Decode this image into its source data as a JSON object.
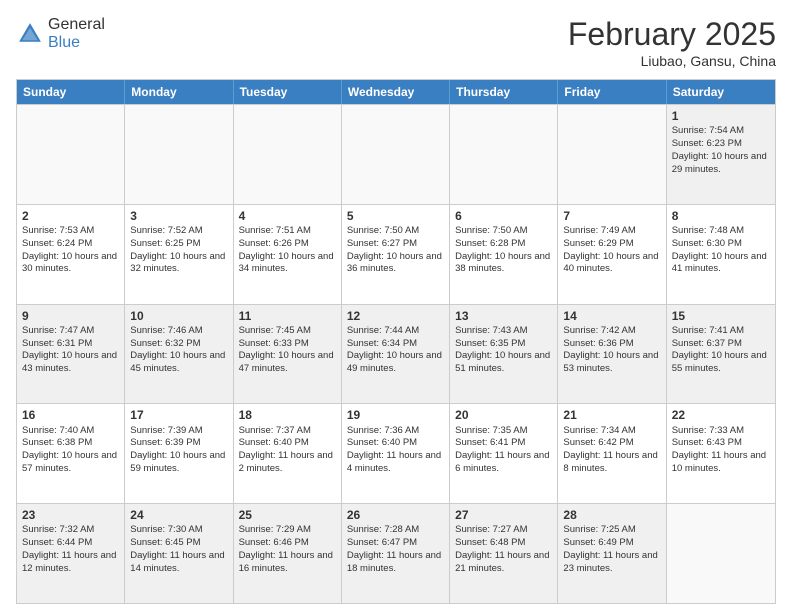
{
  "header": {
    "logo_general": "General",
    "logo_blue": "Blue",
    "month_title": "February 2025",
    "subtitle": "Liubao, Gansu, China"
  },
  "weekdays": [
    "Sunday",
    "Monday",
    "Tuesday",
    "Wednesday",
    "Thursday",
    "Friday",
    "Saturday"
  ],
  "rows": [
    [
      {
        "day": "",
        "info": ""
      },
      {
        "day": "",
        "info": ""
      },
      {
        "day": "",
        "info": ""
      },
      {
        "day": "",
        "info": ""
      },
      {
        "day": "",
        "info": ""
      },
      {
        "day": "",
        "info": ""
      },
      {
        "day": "1",
        "info": "Sunrise: 7:54 AM\nSunset: 6:23 PM\nDaylight: 10 hours and 29 minutes."
      }
    ],
    [
      {
        "day": "2",
        "info": "Sunrise: 7:53 AM\nSunset: 6:24 PM\nDaylight: 10 hours and 30 minutes."
      },
      {
        "day": "3",
        "info": "Sunrise: 7:52 AM\nSunset: 6:25 PM\nDaylight: 10 hours and 32 minutes."
      },
      {
        "day": "4",
        "info": "Sunrise: 7:51 AM\nSunset: 6:26 PM\nDaylight: 10 hours and 34 minutes."
      },
      {
        "day": "5",
        "info": "Sunrise: 7:50 AM\nSunset: 6:27 PM\nDaylight: 10 hours and 36 minutes."
      },
      {
        "day": "6",
        "info": "Sunrise: 7:50 AM\nSunset: 6:28 PM\nDaylight: 10 hours and 38 minutes."
      },
      {
        "day": "7",
        "info": "Sunrise: 7:49 AM\nSunset: 6:29 PM\nDaylight: 10 hours and 40 minutes."
      },
      {
        "day": "8",
        "info": "Sunrise: 7:48 AM\nSunset: 6:30 PM\nDaylight: 10 hours and 41 minutes."
      }
    ],
    [
      {
        "day": "9",
        "info": "Sunrise: 7:47 AM\nSunset: 6:31 PM\nDaylight: 10 hours and 43 minutes."
      },
      {
        "day": "10",
        "info": "Sunrise: 7:46 AM\nSunset: 6:32 PM\nDaylight: 10 hours and 45 minutes."
      },
      {
        "day": "11",
        "info": "Sunrise: 7:45 AM\nSunset: 6:33 PM\nDaylight: 10 hours and 47 minutes."
      },
      {
        "day": "12",
        "info": "Sunrise: 7:44 AM\nSunset: 6:34 PM\nDaylight: 10 hours and 49 minutes."
      },
      {
        "day": "13",
        "info": "Sunrise: 7:43 AM\nSunset: 6:35 PM\nDaylight: 10 hours and 51 minutes."
      },
      {
        "day": "14",
        "info": "Sunrise: 7:42 AM\nSunset: 6:36 PM\nDaylight: 10 hours and 53 minutes."
      },
      {
        "day": "15",
        "info": "Sunrise: 7:41 AM\nSunset: 6:37 PM\nDaylight: 10 hours and 55 minutes."
      }
    ],
    [
      {
        "day": "16",
        "info": "Sunrise: 7:40 AM\nSunset: 6:38 PM\nDaylight: 10 hours and 57 minutes."
      },
      {
        "day": "17",
        "info": "Sunrise: 7:39 AM\nSunset: 6:39 PM\nDaylight: 10 hours and 59 minutes."
      },
      {
        "day": "18",
        "info": "Sunrise: 7:37 AM\nSunset: 6:40 PM\nDaylight: 11 hours and 2 minutes."
      },
      {
        "day": "19",
        "info": "Sunrise: 7:36 AM\nSunset: 6:40 PM\nDaylight: 11 hours and 4 minutes."
      },
      {
        "day": "20",
        "info": "Sunrise: 7:35 AM\nSunset: 6:41 PM\nDaylight: 11 hours and 6 minutes."
      },
      {
        "day": "21",
        "info": "Sunrise: 7:34 AM\nSunset: 6:42 PM\nDaylight: 11 hours and 8 minutes."
      },
      {
        "day": "22",
        "info": "Sunrise: 7:33 AM\nSunset: 6:43 PM\nDaylight: 11 hours and 10 minutes."
      }
    ],
    [
      {
        "day": "23",
        "info": "Sunrise: 7:32 AM\nSunset: 6:44 PM\nDaylight: 11 hours and 12 minutes."
      },
      {
        "day": "24",
        "info": "Sunrise: 7:30 AM\nSunset: 6:45 PM\nDaylight: 11 hours and 14 minutes."
      },
      {
        "day": "25",
        "info": "Sunrise: 7:29 AM\nSunset: 6:46 PM\nDaylight: 11 hours and 16 minutes."
      },
      {
        "day": "26",
        "info": "Sunrise: 7:28 AM\nSunset: 6:47 PM\nDaylight: 11 hours and 18 minutes."
      },
      {
        "day": "27",
        "info": "Sunrise: 7:27 AM\nSunset: 6:48 PM\nDaylight: 11 hours and 21 minutes."
      },
      {
        "day": "28",
        "info": "Sunrise: 7:25 AM\nSunset: 6:49 PM\nDaylight: 11 hours and 23 minutes."
      },
      {
        "day": "",
        "info": ""
      }
    ]
  ]
}
